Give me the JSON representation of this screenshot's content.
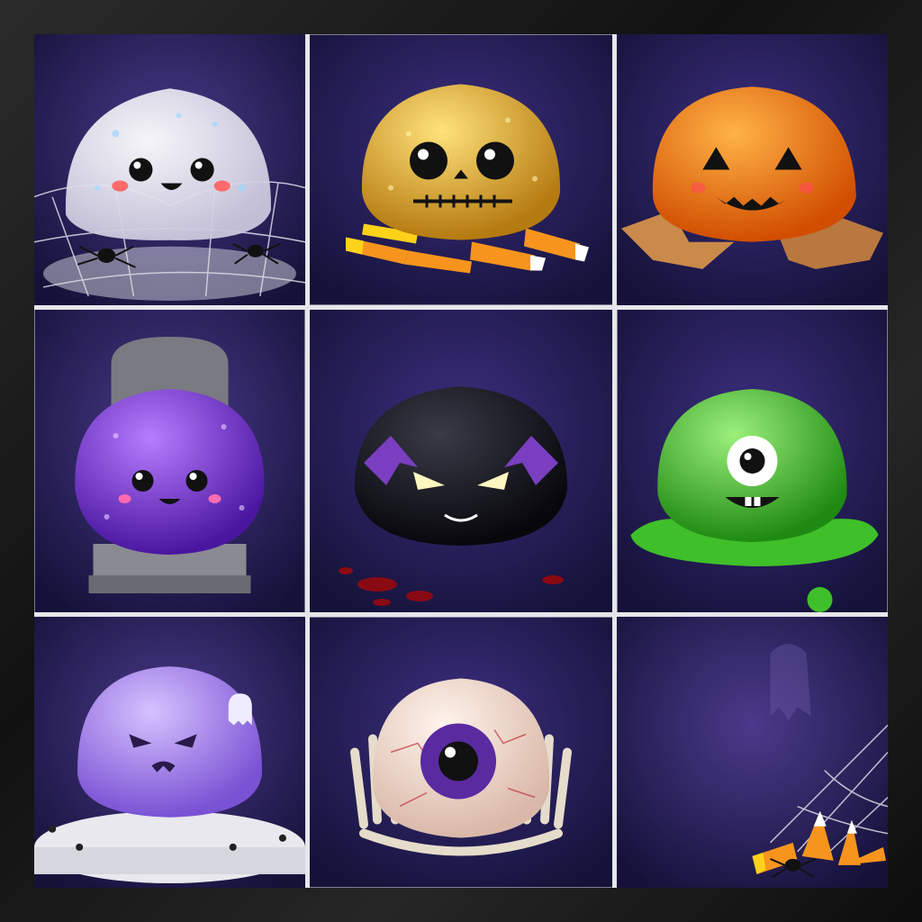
{
  "colors": {
    "frame": "#1c1c1c",
    "divider": "#e6e6ea",
    "background_purple": "#3a2a6e"
  },
  "tiles": [
    {
      "name": "clear-glitter-ghost-squishy",
      "body_color": "#e9e9f2",
      "prop": "spider-web"
    },
    {
      "name": "gold-skull-squishy",
      "body_color": "#d9a62a",
      "prop": "candy-corn"
    },
    {
      "name": "orange-jack-o-lantern-squishy",
      "body_color": "#f07b14",
      "prop": "autumn-leaves"
    },
    {
      "name": "purple-cute-squishy",
      "body_color": "#7a2fd0",
      "prop": "tombstone"
    },
    {
      "name": "black-bat-squishy",
      "body_color": "#1a1a22",
      "prop": "red-drops"
    },
    {
      "name": "green-cyclops-squishy",
      "body_color": "#3fbf2a",
      "prop": "slime-puddle"
    },
    {
      "name": "lavender-ghost-squishy",
      "body_color": "#9a78e6",
      "prop": "white-pedestal"
    },
    {
      "name": "eyeball-squishy",
      "body_color": "#f1ddd0",
      "prop": "skeleton-hands"
    },
    {
      "name": "empty-corner-decor",
      "body_color": "",
      "prop": "candy-corn-and-web"
    }
  ]
}
